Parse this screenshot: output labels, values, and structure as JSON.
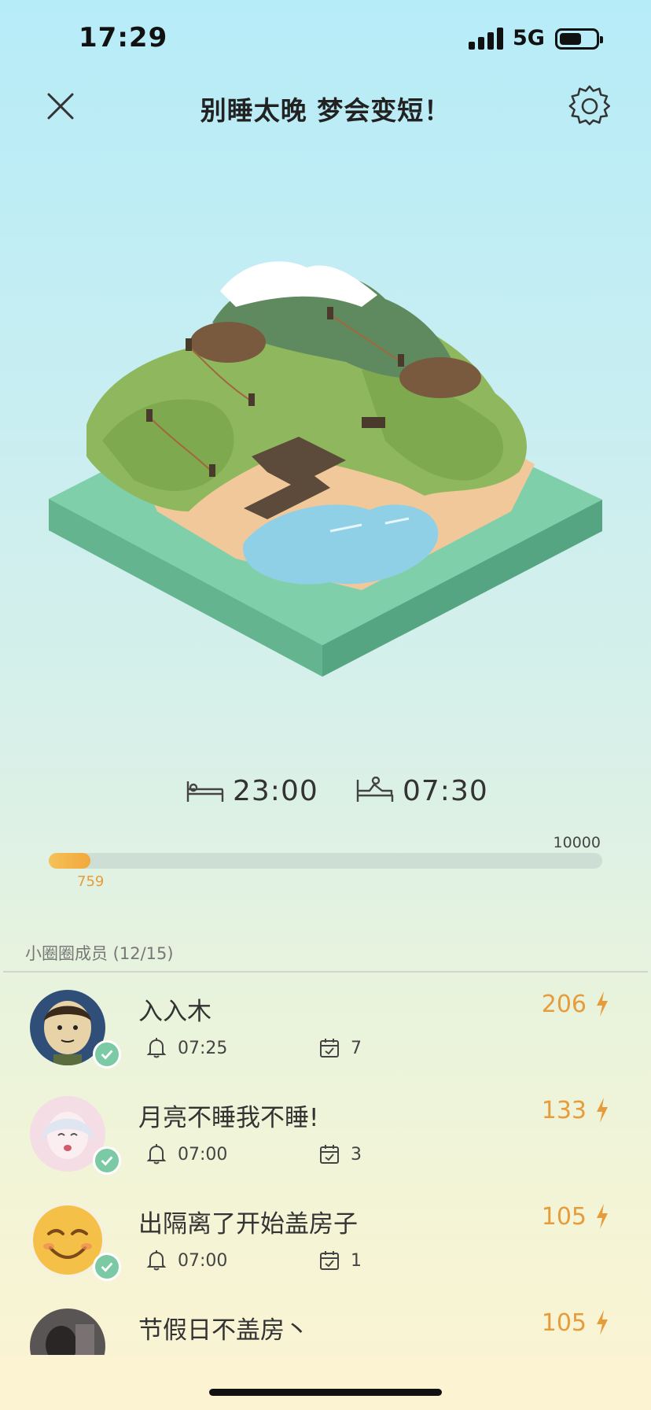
{
  "status_bar": {
    "time": "17:29",
    "network": "5G",
    "battery_level": 0.62
  },
  "header": {
    "title": "别睡太晚 梦会变短！",
    "close_icon": "close-icon",
    "settings_icon": "gear-icon"
  },
  "sleep_schedule": {
    "bedtime": "23:00",
    "wake_time": "07:30",
    "bed_icon": "bed-icon",
    "wake_icon": "wake-up-icon"
  },
  "progress": {
    "current": "759",
    "max": "10000",
    "fraction": 0.0759,
    "color": "#f1a83c"
  },
  "members": {
    "label": "小圈圈成员 (12/15)",
    "items": [
      {
        "name": "入入木",
        "score": "206",
        "alarm": "07:25",
        "days": "7",
        "avatar": "cartoon-boy-avatar"
      },
      {
        "name": "月亮不睡我不睡!",
        "score": "133",
        "alarm": "07:00",
        "days": "3",
        "avatar": "anime-girl-avatar"
      },
      {
        "name": "出隔离了开始盖房子",
        "score": "105",
        "alarm": "07:00",
        "days": "1",
        "avatar": "smiling-emoji-avatar"
      },
      {
        "name": "节假日不盖房丶",
        "score": "105",
        "alarm": "",
        "days": "",
        "avatar": "dark-photo-avatar"
      }
    ]
  },
  "colors": {
    "accent": "#e79c3b",
    "badge": "#7cc9a6",
    "track": "#cddfd5"
  }
}
